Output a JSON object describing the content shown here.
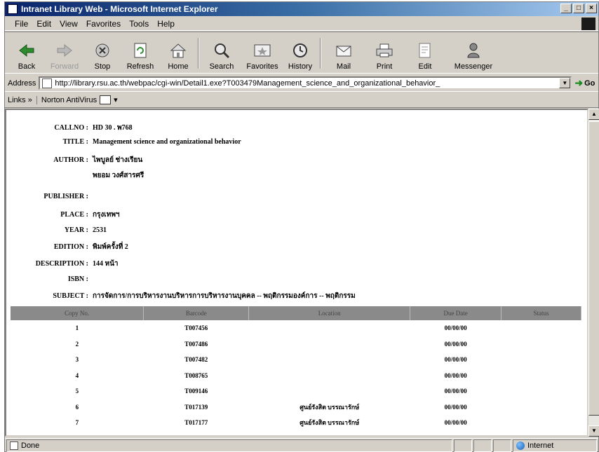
{
  "window": {
    "title": "Intranet Library Web - Microsoft Internet Explorer"
  },
  "menu": [
    "File",
    "Edit",
    "View",
    "Favorites",
    "Tools",
    "Help"
  ],
  "toolbar": {
    "back": "Back",
    "forward": "Forward",
    "stop": "Stop",
    "refresh": "Refresh",
    "home": "Home",
    "search": "Search",
    "favorites": "Favorites",
    "history": "History",
    "mail": "Mail",
    "print": "Print",
    "edit": "Edit",
    "messenger": "Messenger"
  },
  "address": {
    "label": "Address",
    "url": "http://library.rsu.ac.th/webpac/cgi-win/Detail1.exe?T003479Management_science_and_organizational_behavior_",
    "go": "Go"
  },
  "links": {
    "label": "Links",
    "chevron": "»",
    "item": "Norton AntiVirus"
  },
  "record": {
    "callno": {
      "label": "CALLNO :",
      "value": "HD 30 . พ768"
    },
    "title": {
      "label": "TITLE :",
      "value": "Management science and organizational behavior"
    },
    "author": {
      "label": "AUTHOR :",
      "value": "ไพบูลย์ ช่างเรียน",
      "value2": "พยอม วงศ์สารศรี"
    },
    "publisher": {
      "label": "PUBLISHER :",
      "value": ""
    },
    "place": {
      "label": "PLACE :",
      "value": "กรุงเทพฯ"
    },
    "year": {
      "label": "YEAR :",
      "value": "2531"
    },
    "edition": {
      "label": "EDITION :",
      "value": "พิมพ์ครั้งที่ 2"
    },
    "description": {
      "label": "DESCRIPTION :",
      "value": "144 หน้า"
    },
    "isbn": {
      "label": "ISBN :",
      "value": ""
    },
    "subject": {
      "label": "SUBJECT :",
      "value": "การจัดการ/การบริหารงานบริหารการบริหารงานบุคคล -- พฤติกรรมองค์การ -- พฤติกรรม"
    }
  },
  "table": {
    "headers": [
      "Copy No.",
      "Barcode",
      "Location",
      "Due Date",
      "Status"
    ],
    "rows": [
      {
        "copy": "1",
        "barcode": "T007456",
        "location": "",
        "due": "00/00/00"
      },
      {
        "copy": "2",
        "barcode": "T007486",
        "location": "",
        "due": "00/00/00"
      },
      {
        "copy": "3",
        "barcode": "T007482",
        "location": "",
        "due": "00/00/00"
      },
      {
        "copy": "4",
        "barcode": "T008765",
        "location": "",
        "due": "00/00/00"
      },
      {
        "copy": "5",
        "barcode": "T009146",
        "location": "",
        "due": "00/00/00"
      },
      {
        "copy": "6",
        "barcode": "T017139",
        "location": "ศูนย์รังสิต บรรณารักษ์",
        "due": "00/00/00"
      },
      {
        "copy": "7",
        "barcode": "T017177",
        "location": "ศูนย์รังสิต บรรณารักษ์",
        "due": "00/00/00"
      }
    ]
  },
  "status": {
    "text": "Done",
    "zone": "Internet"
  }
}
